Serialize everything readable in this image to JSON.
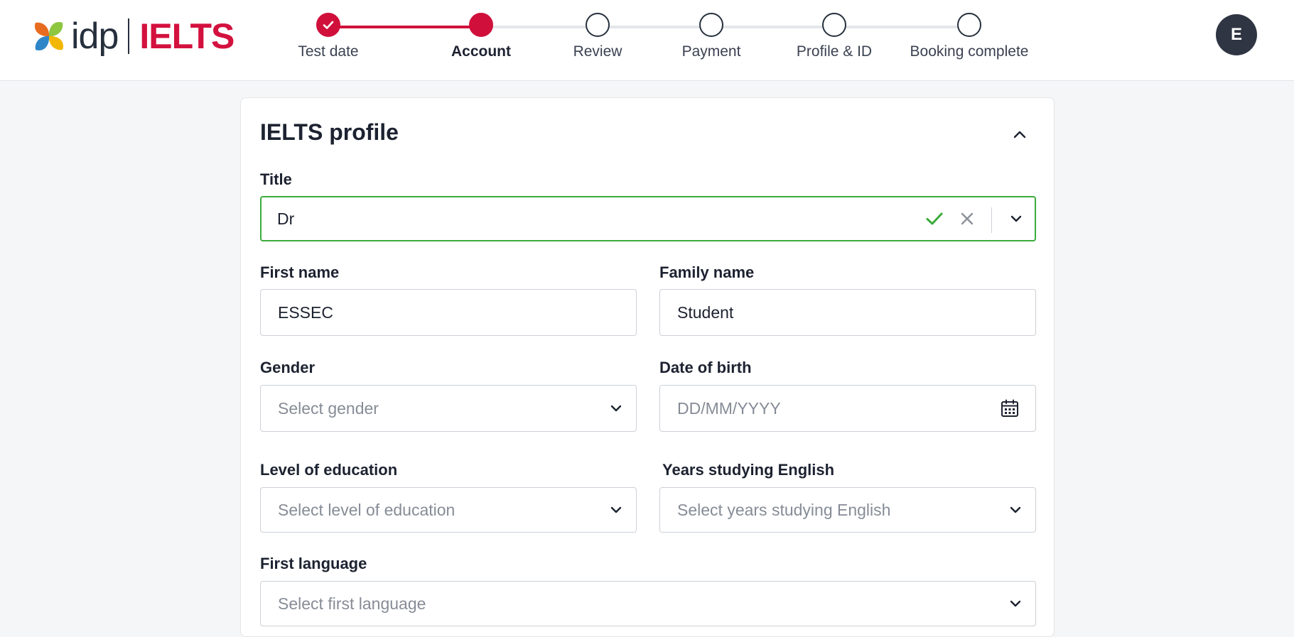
{
  "brand": {
    "idp": "idp",
    "ielts": "IELTS"
  },
  "steps": [
    {
      "label": "Test date",
      "state": "done"
    },
    {
      "label": "Account",
      "state": "active"
    },
    {
      "label": "Review",
      "state": "todo"
    },
    {
      "label": "Payment",
      "state": "todo"
    },
    {
      "label": "Profile & ID",
      "state": "todo"
    },
    {
      "label": "Booking complete",
      "state": "todo"
    }
  ],
  "user": {
    "initial": "E"
  },
  "profile": {
    "title": "IELTS profile",
    "fields": {
      "title": {
        "label": "Title",
        "value": "Dr"
      },
      "first_name": {
        "label": "First name",
        "value": "ESSEC"
      },
      "family_name": {
        "label": "Family name",
        "value": "Student"
      },
      "gender": {
        "label": "Gender",
        "placeholder": "Select gender"
      },
      "dob": {
        "label": "Date of birth",
        "placeholder": "DD/MM/YYYY"
      },
      "education": {
        "label": "Level of education",
        "placeholder": "Select level of education"
      },
      "years_english": {
        "label": "Years studying English",
        "placeholder": "Select years studying English"
      },
      "first_language": {
        "label": "First language",
        "placeholder": "Select first language"
      }
    }
  },
  "colors": {
    "accent": "#d0103b",
    "valid": "#3bab3b",
    "text": "#1c2230"
  },
  "icons": [
    "check-icon",
    "close-icon",
    "chevron-down-icon",
    "chevron-up-icon",
    "calendar-icon"
  ]
}
